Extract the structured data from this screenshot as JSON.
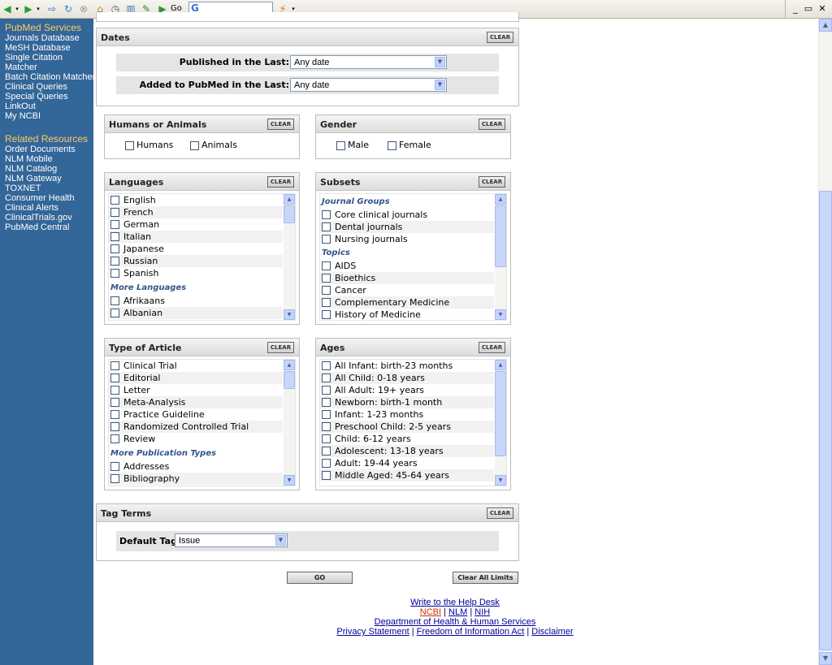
{
  "browser": {
    "go_label": "Go",
    "minimize_glyph": "_",
    "restore_glyph": "▭",
    "close_glyph": "✕"
  },
  "sidebar": {
    "services_title": "PubMed Services",
    "services": [
      "Journals Database",
      "MeSH Database",
      "Single Citation",
      "Matcher",
      "Batch Citation Matcher",
      "Clinical Queries",
      "Special Queries",
      "LinkOut",
      "My NCBI"
    ],
    "resources_title": "Related Resources",
    "resources": [
      "Order Documents",
      "NLM Mobile",
      "NLM Catalog",
      "NLM Gateway",
      "TOXNET",
      "Consumer Health",
      "Clinical Alerts",
      "ClinicalTrials.gov",
      "PubMed Central"
    ]
  },
  "clear_label": "CLEAR",
  "dates": {
    "title": "Dates",
    "published_label": "Published in the Last:",
    "published_value": "Any date",
    "added_label": "Added to PubMed in the Last:",
    "added_value": "Any date"
  },
  "humans": {
    "title": "Humans or Animals",
    "options": [
      "Humans",
      "Animals"
    ]
  },
  "gender": {
    "title": "Gender",
    "options": [
      "Male",
      "Female"
    ]
  },
  "languages": {
    "title": "Languages",
    "items": [
      "English",
      "French",
      "German",
      "Italian",
      "Japanese",
      "Russian",
      "Spanish"
    ],
    "more_label": "More Languages",
    "more_items": [
      "Afrikaans",
      "Albanian"
    ]
  },
  "subsets": {
    "title": "Subsets",
    "group1": "Journal Groups",
    "group1_items": [
      "Core clinical journals",
      "Dental journals",
      "Nursing journals"
    ],
    "group2": "Topics",
    "group2_items": [
      "AIDS",
      "Bioethics",
      "Cancer",
      "Complementary Medicine",
      "History of Medicine"
    ]
  },
  "article_types": {
    "title": "Type of Article",
    "items": [
      "Clinical Trial",
      "Editorial",
      "Letter",
      "Meta-Analysis",
      "Practice Guideline",
      "Randomized Controlled Trial",
      "Review"
    ],
    "more_label": "More Publication Types",
    "more_items": [
      "Addresses",
      "Bibliography"
    ]
  },
  "ages": {
    "title": "Ages",
    "items": [
      "All Infant: birth-23 months",
      "All Child: 0-18 years",
      "All Adult: 19+ years",
      "Newborn: birth-1 month",
      "Infant: 1-23 months",
      "Preschool Child: 2-5 years",
      "Child: 6-12 years",
      "Adolescent: 13-18 years",
      "Adult: 19-44 years",
      "Middle Aged: 45-64 years"
    ]
  },
  "tag_terms": {
    "title": "Tag Terms",
    "default_tag_label": "Default Tag:",
    "default_tag_value": "Issue"
  },
  "actions": {
    "go": "GO",
    "clear_all": "Clear All Limits"
  },
  "footer": {
    "help": "Write to the Help Desk",
    "ncbi": "NCBI",
    "nlm": "NLM",
    "nih": "NIH",
    "dhhs": "Department of Health & Human Services",
    "privacy": "Privacy Statement",
    "foia": "Freedom of Information Act",
    "disclaimer": "Disclaimer",
    "sep": "|"
  },
  "colors": {
    "sidebar_bg": "#336699",
    "sidebar_heading": "#ffcc66",
    "link": "#000099",
    "ncbi_red": "#cc3300"
  }
}
